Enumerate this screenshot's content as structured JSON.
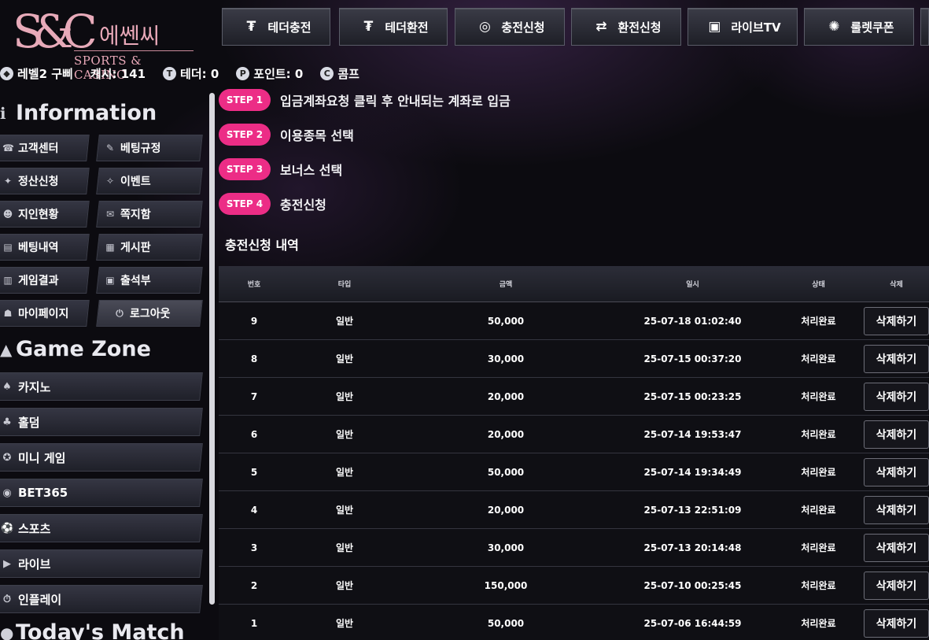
{
  "logo": {
    "monogram": "S&C",
    "korean": "에쎈씨",
    "english": "SPORTS & CASINO"
  },
  "topnav": [
    {
      "label": "테더충전",
      "icon": "tether-charge-icon",
      "glyph": "₮"
    },
    {
      "label": "테더환전",
      "icon": "tether-exchange-icon",
      "glyph": "₮"
    },
    {
      "label": "충전신청",
      "icon": "coins-icon",
      "glyph": "◎"
    },
    {
      "label": "환전신청",
      "icon": "exchange-icon",
      "glyph": "⇄"
    },
    {
      "label": "라이브TV",
      "icon": "live-tv-icon",
      "glyph": "▣"
    },
    {
      "label": "룰렛쿠폰",
      "icon": "roulette-icon",
      "glyph": "✺"
    }
  ],
  "status": {
    "level": "레벨2 구삐",
    "cash": "캐시: 141",
    "tether": "테더: 0",
    "point": "포인트: 0",
    "comp": "콤프"
  },
  "sidebar": {
    "info_title": "Information",
    "info_items": [
      {
        "label": "고객센터",
        "icon": "headset-icon"
      },
      {
        "label": "베팅규정",
        "icon": "rules-icon"
      },
      {
        "label": "정산신청",
        "icon": "settlement-icon"
      },
      {
        "label": "이벤트",
        "icon": "event-icon"
      },
      {
        "label": "지인현황",
        "icon": "friends-icon"
      },
      {
        "label": "쪽지함",
        "icon": "message-icon"
      },
      {
        "label": "베팅내역",
        "icon": "bet-history-icon"
      },
      {
        "label": "게시판",
        "icon": "board-icon"
      },
      {
        "label": "게임결과",
        "icon": "results-icon"
      },
      {
        "label": "출석부",
        "icon": "attendance-icon"
      },
      {
        "label": "마이페이지",
        "icon": "user-icon"
      },
      {
        "label": "로그아웃",
        "icon": "power-icon"
      }
    ],
    "game_title": "Game Zone",
    "game_items": [
      {
        "label": "카지노",
        "icon": "spade-icon"
      },
      {
        "label": "홀덤",
        "icon": "holdem-icon"
      },
      {
        "label": "미니 게임",
        "icon": "minigame-icon"
      },
      {
        "label": "BET365",
        "icon": "bet365-icon"
      },
      {
        "label": "스포츠",
        "icon": "sports-icon"
      },
      {
        "label": "라이브",
        "icon": "live-icon"
      },
      {
        "label": "인플레이",
        "icon": "inplay-icon"
      }
    ],
    "match_title": "Today's Match"
  },
  "steps": [
    {
      "badge": "STEP 1",
      "text": "입금계좌요청 클릭 후 안내되는 계좌로 입금"
    },
    {
      "badge": "STEP 2",
      "text": "이용종목 선택"
    },
    {
      "badge": "STEP 3",
      "text": "보너스 선택"
    },
    {
      "badge": "STEP 4",
      "text": "충전신청"
    }
  ],
  "history": {
    "title": "충전신청 내역",
    "headers": [
      "번호",
      "타입",
      "금액",
      "일시",
      "상태",
      "삭제"
    ],
    "delete_label": "삭제하기",
    "rows": [
      [
        "9",
        "일반",
        "50,000",
        "25-07-18 01:02:40",
        "처리완료"
      ],
      [
        "8",
        "일반",
        "30,000",
        "25-07-15 00:37:20",
        "처리완료"
      ],
      [
        "7",
        "일반",
        "20,000",
        "25-07-15 00:23:25",
        "처리완료"
      ],
      [
        "6",
        "일반",
        "20,000",
        "25-07-14 19:53:47",
        "처리완료"
      ],
      [
        "5",
        "일반",
        "50,000",
        "25-07-14 19:34:49",
        "처리완료"
      ],
      [
        "4",
        "일반",
        "20,000",
        "25-07-13 22:51:09",
        "처리완료"
      ],
      [
        "3",
        "일반",
        "30,000",
        "25-07-13 20:14:48",
        "처리완료"
      ],
      [
        "2",
        "일반",
        "150,000",
        "25-07-10 00:25:45",
        "처리완료"
      ],
      [
        "1",
        "일반",
        "50,000",
        "25-07-06 16:44:59",
        "처리완료"
      ]
    ]
  },
  "colors": {
    "accent": "#ec2d86",
    "background": "#0c0b10",
    "logo": "#e8a8b8"
  }
}
